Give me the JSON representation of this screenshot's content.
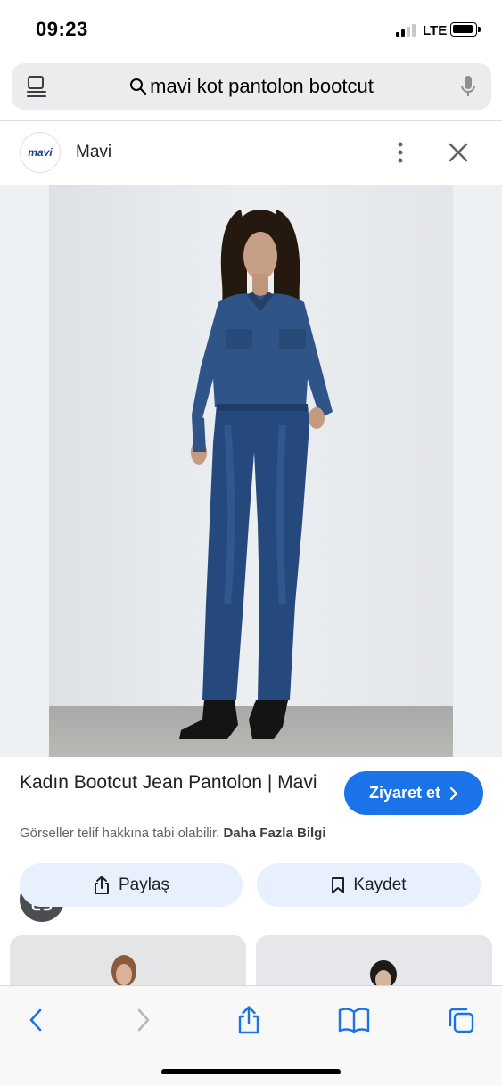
{
  "status_bar": {
    "time": "09:23",
    "network": "LTE",
    "battery_icon": "battery-icon",
    "signal_icon": "signal-icon"
  },
  "search": {
    "query": "mavi kot pantolon bootcut",
    "reader_icon": "reader-icon",
    "mic_icon": "microphone-icon"
  },
  "source": {
    "logo_text": "mavi",
    "name": "Mavi"
  },
  "result": {
    "title": "Kadın Bootcut Jean Pantolon | Mavi",
    "visit_label": "Ziyaret et",
    "copyright_text": "Görseller telif hakkına tabi olabilir.",
    "more_info_label": "Daha Fazla Bilgi"
  },
  "actions": {
    "share_label": "Paylaş",
    "save_label": "Kaydet"
  },
  "toolbar": {
    "items": [
      "back-icon",
      "forward-icon",
      "share-icon",
      "bookmarks-icon",
      "tabs-icon"
    ]
  },
  "colors": {
    "accent": "#1a73e8",
    "action_bg": "#e8f0fe",
    "search_bg": "#ececee",
    "denim": "#2f4f80"
  }
}
